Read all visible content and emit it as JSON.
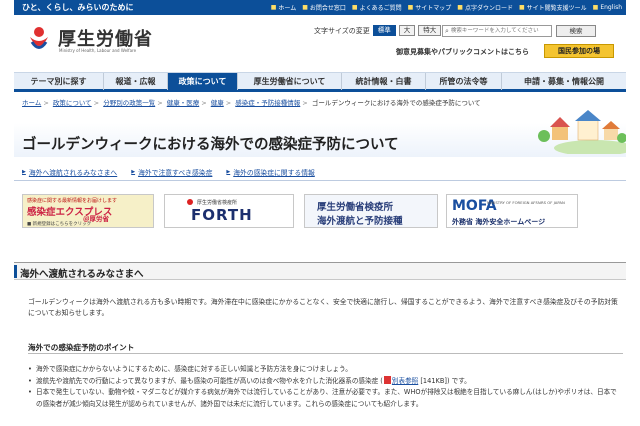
{
  "header": {
    "tagline": "ひと、くらし、みらいのために",
    "top_links": [
      "ホーム",
      "お問合せ窓口",
      "よくあるご質問",
      "サイトマップ",
      "点字ダウンロード",
      "サイト閲覧支援ツール",
      "English"
    ],
    "logo_text": "厚生労働省",
    "logo_sub": "Ministry of Health, Labour and Welfare",
    "font_size_label": "文字サイズの変更",
    "font_sizes": [
      "標準",
      "大",
      "特大"
    ],
    "search_placeholder": "検索キーワードを入力してください",
    "search_button": "検索",
    "opinion_link": "御意見募集やパブリックコメントはこちら",
    "join_button": "国民参加の場"
  },
  "nav": {
    "items": [
      "テーマ別に探す",
      "報道・広報",
      "政策について",
      "厚生労働省について",
      "統計情報・白書",
      "所管の法令等",
      "申請・募集・情報公開"
    ]
  },
  "breadcrumb": {
    "items": [
      "ホーム",
      "政策について",
      "分野別の政策一覧",
      "健康・医療",
      "健康",
      "感染症・予防接種情報"
    ],
    "current": "ゴールデンウィークにおける海外での感染症予防について"
  },
  "page": {
    "title": "ゴールデンウィークにおける海外での感染症予防について",
    "anchors": [
      "海外へ渡航されるみなさまへ",
      "海外で注意すべき感染症",
      "海外の感染症に関する情報"
    ]
  },
  "banners": {
    "b1": {
      "t1": "感染症に関する最新情報をお届けします",
      "t2": "感染症エクスプレス",
      "t3": "＠厚労省",
      "t4": "■ 新規登録はこちらをクリック"
    },
    "b2": {
      "t1": "厚生労働省検疫所",
      "t2": "FORTH"
    },
    "b3": {
      "t1": "厚生労働省検疫所",
      "t2": "海外渡航と予防接種"
    },
    "b4": {
      "mofa": "MOFA",
      "t1": "MINISTRY OF FOREIGN AFFAIRS OF JAPAN",
      "t2": "外務省 海外安全ホームページ"
    }
  },
  "section1": {
    "heading": "海外へ渡航されるみなさまへ",
    "text": "ゴールデンウィークは海外へ渡航される方も多い時期です。海外滞在中に感染症にかかることなく、安全で快適に旅行し、帰国することができるよう、海外で注意すべき感染症及びその予防対策についてお知らせします。"
  },
  "section2": {
    "heading": "海外での感染症予防のポイント",
    "bullets": [
      {
        "text": "海外で感染症にかからないようにするために、感染症に対する正しい知識と予防方法を身につけましょう。"
      },
      {
        "pre": "渡航先や渡航先での行動によって異なりますが、最も感染の可能性が高いのは食べ物や水を介した消化器系の感染症 (",
        "link": "別表参照",
        "post": " [141KB]) です。"
      },
      {
        "text": "日本で発生していない、動物や蚊・マダニなどが媒介する病気が海外では流行していることがあり、注意が必要です。また、WHOが排除又は根絶を目指している麻しん(はしか)やポリオは、日本での感染者が減少傾向又は発生が認められていませんが、諸外国では未だに流行しています。これらの感染症についても紹介します。"
      }
    ]
  }
}
